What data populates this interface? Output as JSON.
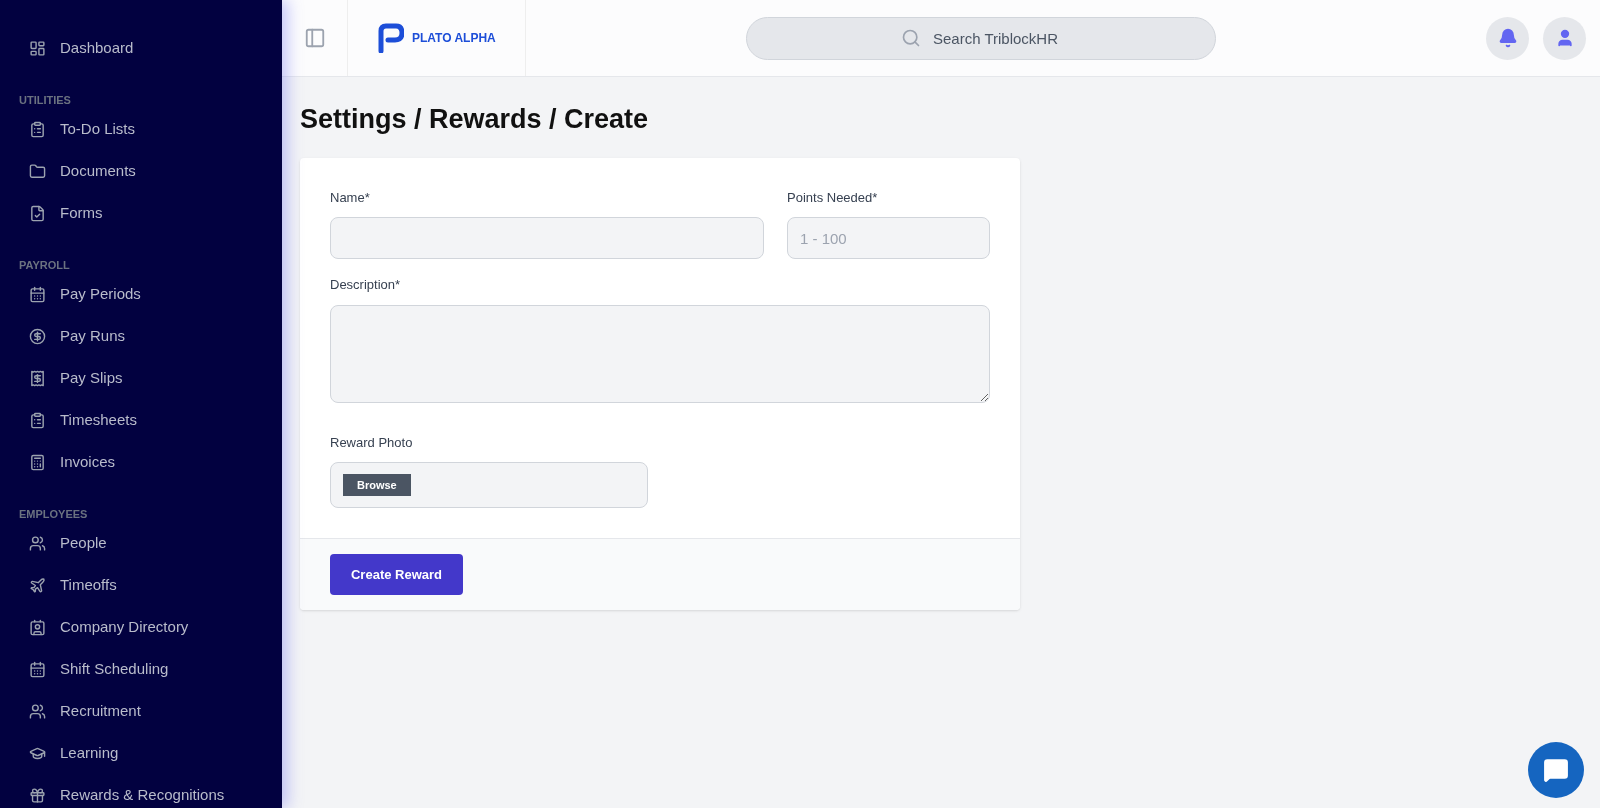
{
  "sidebar": {
    "sections": [
      {
        "items": [
          {
            "label": "Dashboard"
          }
        ]
      },
      {
        "heading": "UTILITIES",
        "items": [
          {
            "label": "To-Do Lists"
          },
          {
            "label": "Documents"
          },
          {
            "label": "Forms"
          }
        ]
      },
      {
        "heading": "PAYROLL",
        "items": [
          {
            "label": "Pay Periods"
          },
          {
            "label": "Pay Runs"
          },
          {
            "label": "Pay Slips"
          },
          {
            "label": "Timesheets"
          },
          {
            "label": "Invoices"
          }
        ]
      },
      {
        "heading": "EMPLOYEES",
        "items": [
          {
            "label": "People"
          },
          {
            "label": "Timeoffs"
          },
          {
            "label": "Company Directory"
          },
          {
            "label": "Shift Scheduling"
          },
          {
            "label": "Recruitment"
          },
          {
            "label": "Learning"
          },
          {
            "label": "Rewards & Recognitions"
          }
        ]
      }
    ]
  },
  "header": {
    "logo": "PLATO ALPHA",
    "search": {
      "placeholder": "Search TriblockHR"
    }
  },
  "page": {
    "title": "Settings / Rewards / Create"
  },
  "form": {
    "name": {
      "label": "Name*"
    },
    "points": {
      "label": "Points Needed*",
      "placeholder": "1 - 100"
    },
    "description": {
      "label": "Description*"
    },
    "photo": {
      "label": "Reward Photo",
      "button": "Browse"
    },
    "submit": "Create Reward"
  }
}
